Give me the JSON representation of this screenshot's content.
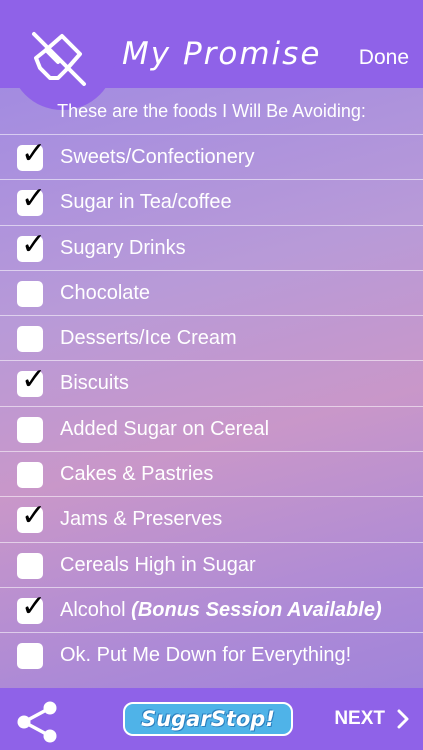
{
  "header": {
    "title": "My Promise",
    "done_label": "Done",
    "icon": "mute-speaker-icon"
  },
  "subtitle": "These are the foods I Will Be Avoiding:",
  "items": [
    {
      "label": "Sweets/Confectionery",
      "checked": true
    },
    {
      "label": "Sugar in Tea/coffee",
      "checked": true
    },
    {
      "label": "Sugary Drinks",
      "checked": true
    },
    {
      "label": "Chocolate",
      "checked": false
    },
    {
      "label": "Desserts/Ice Cream",
      "checked": false
    },
    {
      "label": "Biscuits",
      "checked": true
    },
    {
      "label": "Added Sugar on Cereal",
      "checked": false
    },
    {
      "label": "Cakes & Pastries",
      "checked": false
    },
    {
      "label": "Jams & Preserves",
      "checked": true
    },
    {
      "label": "Cereals High in Sugar",
      "checked": false
    },
    {
      "label": "Alcohol",
      "note": "(Bonus Session Available)",
      "checked": true
    },
    {
      "label": "Ok. Put Me Down for Everything!",
      "checked": false
    }
  ],
  "footer": {
    "logo_text": "SugarStop!",
    "next_label": "NEXT",
    "share_icon": "share-icon"
  },
  "colors": {
    "accent": "#8f62e8",
    "logo_blue": "#4fb3e8"
  }
}
